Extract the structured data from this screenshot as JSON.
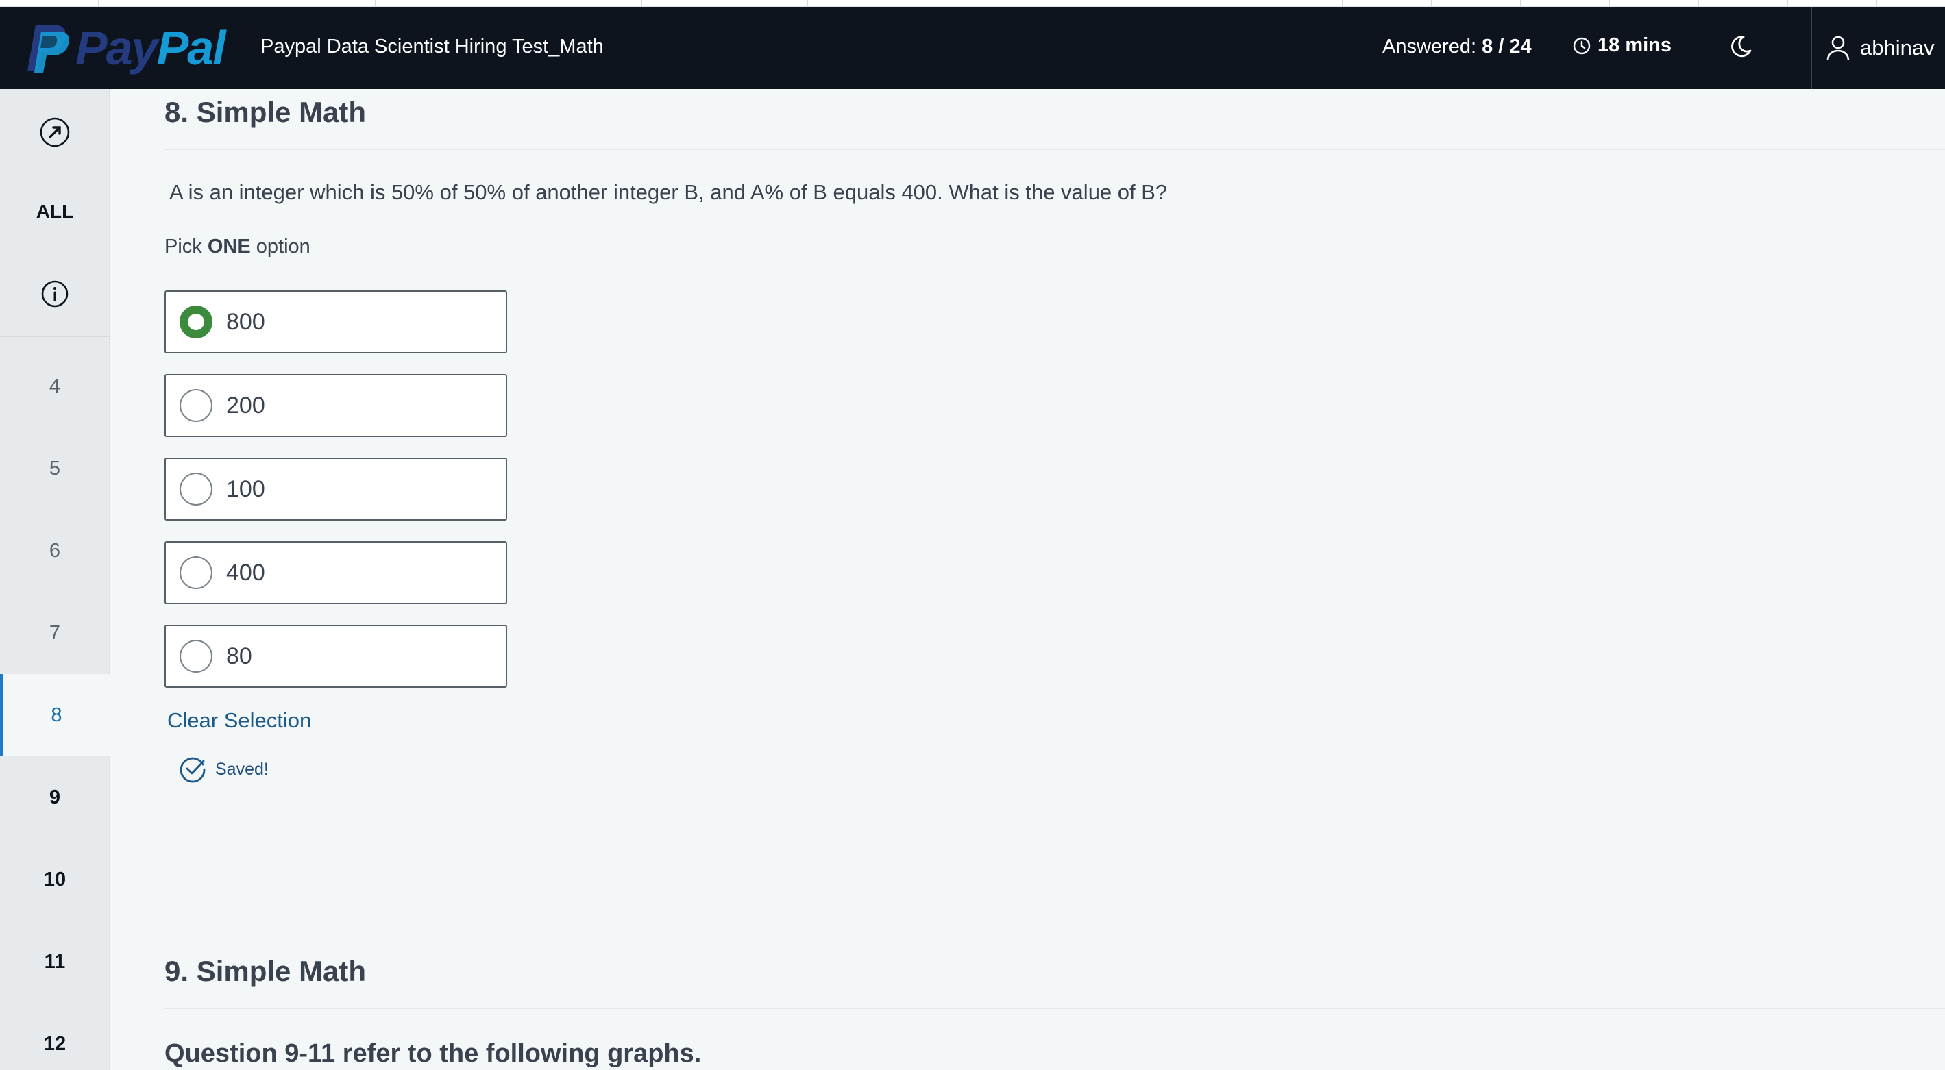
{
  "header": {
    "logo_pay": "Pay",
    "logo_pal": "Pal",
    "test_title": "Paypal Data Scientist Hiring Test_Math",
    "answered_label": "Answered:",
    "answered_value": "8 / 24",
    "timer": "18 mins",
    "username": "abhinav"
  },
  "sidebar": {
    "all_label": "ALL",
    "questions": [
      "4",
      "5",
      "6",
      "7",
      "8",
      "9",
      "10",
      "11",
      "12"
    ],
    "active_question": "8"
  },
  "question8": {
    "title": "8. Simple Math",
    "text": "A is an integer which is 50% of 50% of another integer B, and A% of B equals 400. What is the value of B?",
    "pick_prefix": "Pick",
    "pick_bold": "ONE",
    "pick_suffix": "option",
    "options": [
      "800",
      "200",
      "100",
      "400",
      "80"
    ],
    "selected": "800",
    "clear_label": "Clear Selection",
    "saved_label": "Saved!"
  },
  "question9": {
    "title": "9. Simple Math",
    "note": "Question 9-11 refer to the following graphs."
  },
  "colors": {
    "header_bg": "#0e141e",
    "selected_green": "#3b8a3e",
    "active_blue": "#1f78c8",
    "link_blue": "#1d5a8a"
  }
}
